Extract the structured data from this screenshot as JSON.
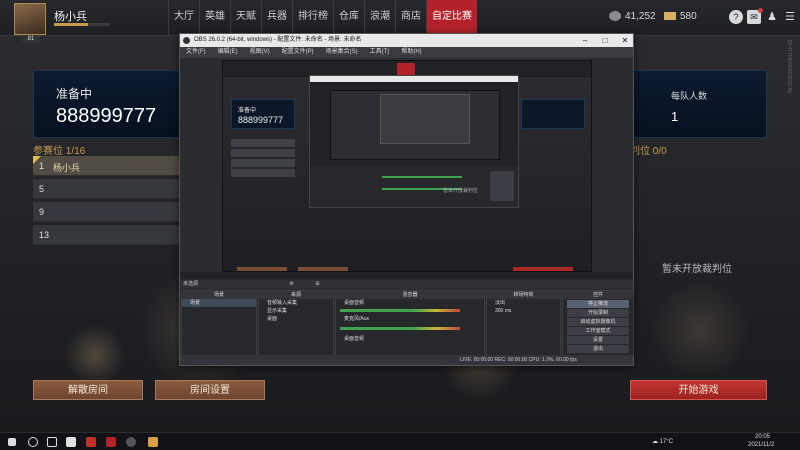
{
  "user": {
    "name": "杨小兵",
    "level": "81"
  },
  "nav": {
    "items": [
      "大厅",
      "英雄",
      "天赋",
      "兵器",
      "排行榜",
      "仓库",
      "浪潮",
      "商店",
      "自定比赛"
    ],
    "active_index": 8
  },
  "currency": {
    "silver": "41,252",
    "gold": "580"
  },
  "room": {
    "status": "准备中",
    "id": "888999777",
    "slots_label": "参赛位 1/16",
    "slots": [
      {
        "num": "1",
        "name": "杨小兵"
      },
      {
        "num": "5",
        "name": ""
      },
      {
        "num": "9",
        "name": ""
      },
      {
        "num": "13",
        "name": ""
      }
    ]
  },
  "right_panel": {
    "team_size_label": "每队人数",
    "team_size_value": "1",
    "referee_label": "判位 0/0",
    "referee_empty": "暂未开放裁判位"
  },
  "buttons": {
    "dissolve": "解散房间",
    "settings": "房间设置",
    "start": "开始游戏"
  },
  "obs": {
    "title": "OBS 26.0.2 (64-bit, windows) - 配置文件: 未命名 - 场景: 未命名",
    "menu": [
      "文件(F)",
      "编辑(E)",
      "视图(V)",
      "配置文件(P)",
      "场景集合(S)",
      "工具(T)",
      "帮助(H)"
    ],
    "source_bar": "未选源",
    "docks": {
      "scenes": {
        "title": "场景",
        "items": [
          "场景"
        ]
      },
      "sources": {
        "title": "来源",
        "items": [
          "音频输入采集",
          "显示采集",
          "桌面"
        ]
      },
      "mixer": {
        "title": "混音器",
        "channels": [
          "桌面音频",
          "麦克风/Aux",
          "桌面音频"
        ]
      },
      "transitions": {
        "title": "转场特效",
        "type": "淡出",
        "duration": "300 ms"
      },
      "controls": {
        "title": "控件",
        "buttons": [
          "停止推流",
          "开始录制",
          "启动虚拟摄像机",
          "工作室模式",
          "设置",
          "退出"
        ]
      }
    },
    "footer": "LIVE: 00:00:00   REC: 00:00:00   CPU: 1.9%, 60.00 fps"
  },
  "side_id": "ID:4770909016353(CN)",
  "taskbar": {
    "weather": "17°C",
    "time": "20:05",
    "date": "2021/11/2"
  }
}
